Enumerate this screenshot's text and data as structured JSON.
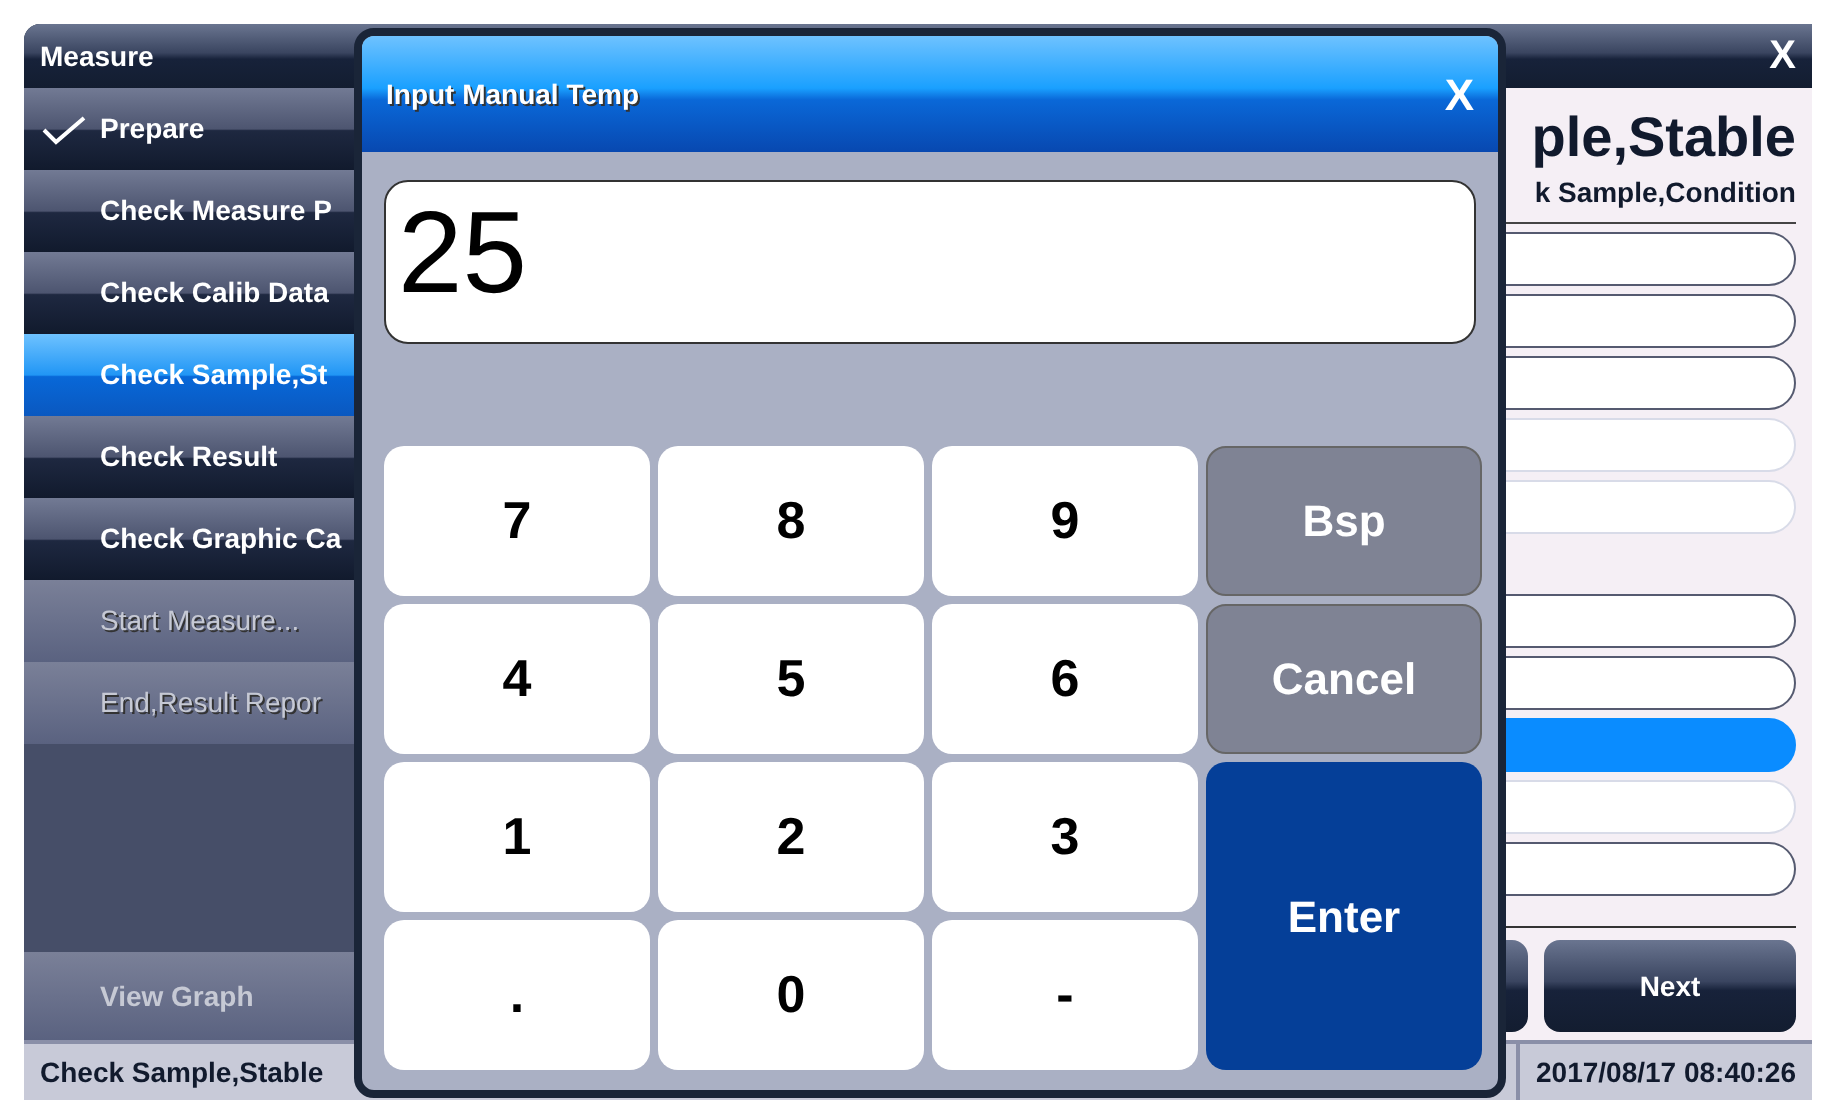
{
  "window": {
    "title": "Measure",
    "close": "X"
  },
  "sidebar": {
    "items": [
      {
        "label": "Prepare",
        "checked": true,
        "selected": false,
        "disabled": false
      },
      {
        "label": "Check Measure P",
        "checked": false,
        "selected": false,
        "disabled": false
      },
      {
        "label": "Check Calib Data",
        "checked": false,
        "selected": false,
        "disabled": false
      },
      {
        "label": "Check Sample,St",
        "checked": false,
        "selected": true,
        "disabled": false
      },
      {
        "label": "Check Result",
        "checked": false,
        "selected": false,
        "disabled": false
      },
      {
        "label": "Check Graphic Ca",
        "checked": false,
        "selected": false,
        "disabled": false
      },
      {
        "label": "Start Measure...",
        "checked": false,
        "selected": false,
        "disabled": true
      },
      {
        "label": "End,Result Repor",
        "checked": false,
        "selected": false,
        "disabled": true
      }
    ],
    "footer_button": {
      "label": "View Graph",
      "disabled": true
    }
  },
  "main": {
    "title": "ple,Stable",
    "subtitle": "k Sample,Condition",
    "field_groups": [
      [
        {
          "selected": false,
          "disabled": false
        },
        {
          "selected": false,
          "disabled": false
        },
        {
          "selected": false,
          "disabled": false
        },
        {
          "selected": false,
          "disabled": true
        },
        {
          "selected": false,
          "disabled": true
        }
      ],
      [
        {
          "selected": false,
          "disabled": false
        },
        {
          "selected": false,
          "disabled": false
        },
        {
          "selected": true,
          "disabled": false
        },
        {
          "selected": false,
          "disabled": true
        },
        {
          "selected": false,
          "disabled": false
        }
      ]
    ],
    "buttons": [
      {
        "kind": "blank"
      },
      {
        "kind": "text",
        "label": "Next"
      }
    ]
  },
  "status_bar": {
    "step": "Check Sample,Stable",
    "datetime": "2017/08/17 08:40:26"
  },
  "dialog": {
    "title": "Input Manual Temp",
    "close": "X",
    "value": "25",
    "keys": [
      {
        "label": "7",
        "kind": "digit"
      },
      {
        "label": "8",
        "kind": "digit"
      },
      {
        "label": "9",
        "kind": "digit"
      },
      {
        "label": "Bsp",
        "kind": "action"
      },
      {
        "label": "4",
        "kind": "digit"
      },
      {
        "label": "5",
        "kind": "digit"
      },
      {
        "label": "6",
        "kind": "digit"
      },
      {
        "label": "Cancel",
        "kind": "action"
      },
      {
        "label": "1",
        "kind": "digit"
      },
      {
        "label": "2",
        "kind": "digit"
      },
      {
        "label": "3",
        "kind": "digit"
      },
      {
        "label": "Enter",
        "kind": "enter"
      },
      {
        "label": ".",
        "kind": "digit"
      },
      {
        "label": "0",
        "kind": "digit"
      },
      {
        "label": "-",
        "kind": "digit"
      }
    ]
  }
}
